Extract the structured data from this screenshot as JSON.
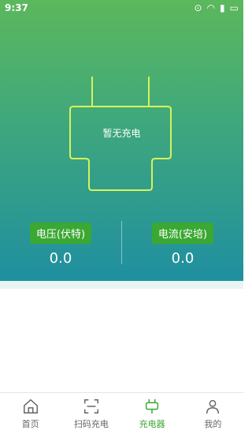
{
  "status_bar": {
    "time": "9:37"
  },
  "charging": {
    "status_text": "暂无充电",
    "voltage_label": "电压(伏特)",
    "voltage_value": "0.0",
    "current_label": "电流(安培)",
    "current_value": "0.0"
  },
  "tabs": [
    {
      "label": "首页",
      "icon": "home-icon"
    },
    {
      "label": "扫码充电",
      "icon": "scan-icon"
    },
    {
      "label": "充电器",
      "icon": "charger-icon"
    },
    {
      "label": "我的",
      "icon": "person-icon"
    }
  ],
  "colors": {
    "accent": "#3aa832",
    "gradient_top": "#5cb85c",
    "gradient_bottom": "#1f8fa0",
    "plug_outline": "#d7f25a"
  }
}
